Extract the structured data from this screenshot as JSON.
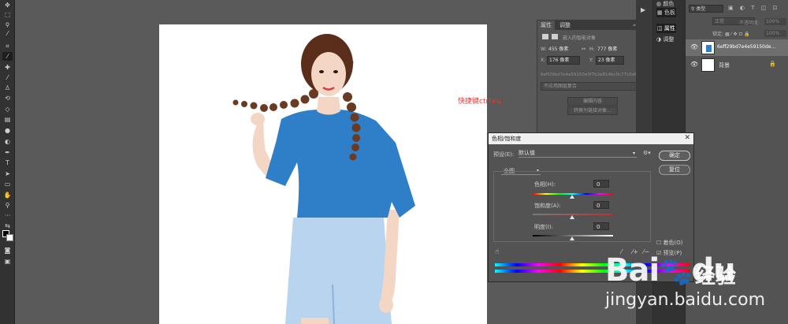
{
  "annotation": {
    "shortcut": "快捷键ctrl+u"
  },
  "toolbar": {
    "tools": [
      "move-tool",
      "marquee-tool",
      "lasso-tool",
      "quick-select-tool",
      "crop-tool",
      "eyedropper-tool",
      "healing-tool",
      "brush-tool",
      "stamp-tool",
      "history-brush-tool",
      "eraser-tool",
      "gradient-tool",
      "blur-tool",
      "dodge-tool",
      "pen-tool",
      "type-tool",
      "path-select-tool",
      "shape-tool",
      "hand-tool",
      "zoom-tool",
      "more-tools",
      "swap-colors",
      "foreground-color",
      "quick-mask",
      "screen-mode"
    ]
  },
  "properties_panel": {
    "tabs": [
      "属性",
      "调整"
    ],
    "header": "嵌入的智能对象",
    "w_label": "W:",
    "w_value": "455 像素",
    "h_label": "H:",
    "h_value": "777 像素",
    "x_label": "X:",
    "x_value": "176 像素",
    "y_label": "Y:",
    "y_value": "23 像素",
    "filename": "6eff29bd7e4e59150e0f7b2e814bc0c77c0d6d8...",
    "comp_select": "不应用图层复合",
    "edit_btn": "编辑内容",
    "convert_btn": "转换为链接对象..."
  },
  "dock": {
    "items": [
      {
        "label": "颜色",
        "icon": "color-icon"
      },
      {
        "label": "色板",
        "icon": "swatches-icon"
      },
      {
        "label": "属性",
        "icon": "properties-icon"
      },
      {
        "label": "调整",
        "icon": "adjust-icon"
      }
    ]
  },
  "layers_panel": {
    "filter_label": "类型",
    "blend_mode": "正常",
    "opacity_label": "不透明度:",
    "opacity_value": "100%",
    "lock_label": "锁定:",
    "fill_label": "填充:",
    "fill_value": "100%",
    "layers": [
      {
        "name": "6eff29bd7e4e59150de...",
        "selected": true
      },
      {
        "name": "背景",
        "selected": false
      }
    ]
  },
  "dialog": {
    "title": "色相/饱和度",
    "preset_label": "预设(E):",
    "preset_value": "默认值",
    "ok": "确定",
    "reset": "复位",
    "channel": "全图",
    "hue_label": "色相(H):",
    "hue_value": "0",
    "sat_label": "饱和度(A):",
    "sat_value": "0",
    "light_label": "明度(I):",
    "light_value": "0",
    "colorize": "着色(O)",
    "preview": "预览(P)"
  },
  "watermark": {
    "logo": "Bai",
    "logo_du": "du",
    "cn": "经验",
    "url": "jingyan.baidu.com"
  },
  "colors": {
    "shirt": "#2f7fc8",
    "skirt": "#b8d4ef",
    "hair": "#5a2e1a",
    "skin": "#f4d6c4",
    "annotation": "#e53838"
  }
}
